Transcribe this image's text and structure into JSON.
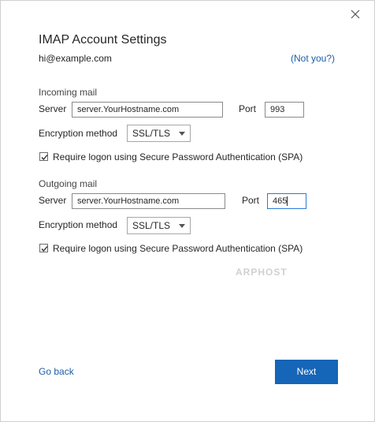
{
  "dialog": {
    "title": "IMAP Account Settings",
    "email": "hi@example.com",
    "not_you_link": "(Not you?)",
    "close_icon": "close-icon"
  },
  "incoming": {
    "heading": "Incoming mail",
    "server_label": "Server",
    "server_value": "server.YourHostname.com",
    "port_label": "Port",
    "port_value": "993",
    "encryption_label": "Encryption method",
    "encryption_value": "SSL/TLS",
    "spa_label": "Require logon using Secure Password Authentication (SPA)",
    "spa_checked": true
  },
  "outgoing": {
    "heading": "Outgoing mail",
    "server_label": "Server",
    "server_value": "server.YourHostname.com",
    "port_label": "Port",
    "port_value": "465",
    "encryption_label": "Encryption method",
    "encryption_value": "SSL/TLS",
    "spa_label": "Require logon using Secure Password Authentication (SPA)",
    "spa_checked": true
  },
  "watermark": "ARPHOST",
  "footer": {
    "back_label": "Go back",
    "next_label": "Next"
  },
  "colors": {
    "accent": "#1565b8",
    "link": "#1a5fa8"
  }
}
